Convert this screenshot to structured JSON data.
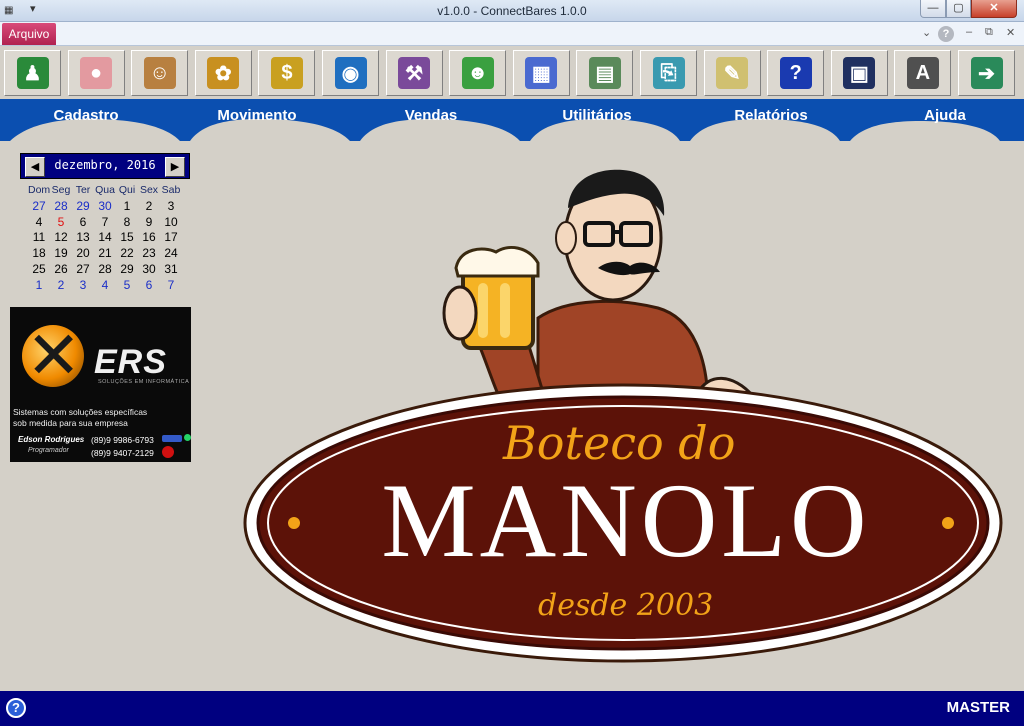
{
  "window": {
    "title": "v1.0.0  -  ConnectBares 1.0.0"
  },
  "ribbon": {
    "file_tab": "Arquivo"
  },
  "toolbar": {
    "buttons": [
      {
        "icon": "person-icon",
        "color": "#2a8a3a",
        "glyph": "♟"
      },
      {
        "icon": "piggy-bank-icon",
        "color": "#e39aa0",
        "glyph": "●"
      },
      {
        "icon": "caveman-icon",
        "color": "#b88040",
        "glyph": "☺"
      },
      {
        "icon": "cat-icon",
        "color": "#c89020",
        "glyph": "✿"
      },
      {
        "icon": "coins-icon",
        "color": "#c9a020",
        "glyph": "$"
      },
      {
        "icon": "globe-icon",
        "color": "#1f6fc0",
        "glyph": "◉"
      },
      {
        "icon": "tools-icon",
        "color": "#7a4a9a",
        "glyph": "⚒"
      },
      {
        "icon": "users-icon",
        "color": "#3aa040",
        "glyph": "☻"
      },
      {
        "icon": "table-settings-icon",
        "color": "#4a6ad0",
        "glyph": "▦"
      },
      {
        "icon": "calculator-icon",
        "color": "#5a8a5a",
        "glyph": "▤"
      },
      {
        "icon": "network-icon",
        "color": "#3a9ab0",
        "glyph": "⎘"
      },
      {
        "icon": "chart-icon",
        "color": "#d0c070",
        "glyph": "✎"
      },
      {
        "icon": "help-icon",
        "color": "#1a3ab0",
        "glyph": "?"
      },
      {
        "icon": "monitor-icon",
        "color": "#203060",
        "glyph": "▣"
      },
      {
        "icon": "floppy-disk-icon",
        "color": "#505050",
        "glyph": "A"
      },
      {
        "icon": "exit-door-icon",
        "color": "#2a8a5a",
        "glyph": "➔"
      }
    ]
  },
  "menu": {
    "items": [
      "Cadastro",
      "Movimento",
      "Vendas",
      "Utilitários",
      "Relatórios",
      "Ajuda"
    ]
  },
  "calendar": {
    "month_label": "dezembro, 2016",
    "weekdays": [
      "Dom",
      "Seg",
      "Ter",
      "Qua",
      "Qui",
      "Sex",
      "Sab"
    ],
    "weeks": [
      [
        "27",
        "28",
        "29",
        "30",
        "1",
        "2",
        "3"
      ],
      [
        "4",
        "5",
        "6",
        "7",
        "8",
        "9",
        "10"
      ],
      [
        "11",
        "12",
        "13",
        "14",
        "15",
        "16",
        "17"
      ],
      [
        "18",
        "19",
        "20",
        "21",
        "22",
        "23",
        "24"
      ],
      [
        "25",
        "26",
        "27",
        "28",
        "29",
        "30",
        "31"
      ],
      [
        "1",
        "2",
        "3",
        "4",
        "5",
        "6",
        "7"
      ]
    ],
    "today": "5"
  },
  "banner": {
    "brand": "ERS",
    "tagline": "SOLUÇÕES EM INFORMÁTICA",
    "description_line1": "Sistemas com soluções específicas",
    "description_line2": "sob medida para sua empresa",
    "person": "Edson Rodrigues",
    "role": "Programador",
    "phone1": "(89)9 9986-6793",
    "phone2": "(89)9 9407-2129"
  },
  "logo": {
    "line1": "Boteco do",
    "line2": "MANOLO",
    "line3": "desde 2003"
  },
  "status": {
    "user": "MASTER"
  }
}
